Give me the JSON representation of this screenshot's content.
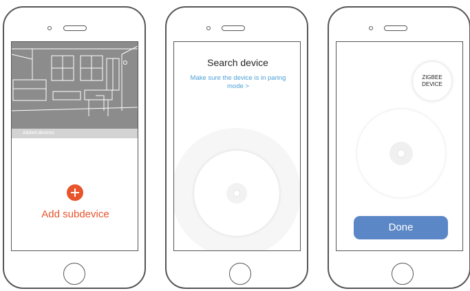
{
  "phones": [
    {
      "added_devices_label": "Added devices",
      "add_subdevice_label": "Add subdevice"
    },
    {
      "title": "Search device",
      "hint": "Make sure the device is in paring mode >"
    },
    {
      "zigbee_badge": "ZIGBEE\nDEVICE",
      "done_label": "Done"
    }
  ],
  "colors": {
    "accent_orange": "#e8542c",
    "link_blue": "#4a9fd6",
    "done_button": "#5b87c6",
    "phone_outline": "#555555"
  },
  "icons": [
    "plus-icon",
    "home-button",
    "speaker-icon"
  ]
}
